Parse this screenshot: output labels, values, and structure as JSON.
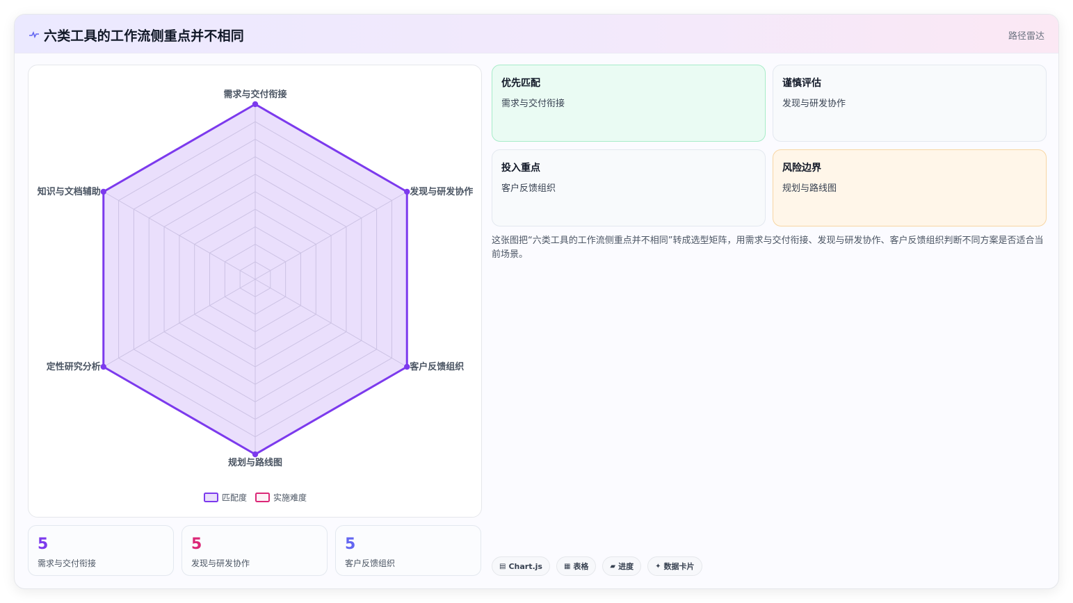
{
  "header": {
    "title": "六类工具的工作流侧重点并不相同",
    "tag": "路径雷达",
    "icon": "pulse-icon"
  },
  "chart_data": {
    "type": "radar",
    "categories": [
      "需求与交付衔接",
      "发现与研发协作",
      "客户反馈组织",
      "规划与路线图",
      "定性研究分析",
      "知识与文档辅助"
    ],
    "series": [
      {
        "name": "匹配度",
        "values": [
          5,
          5,
          5,
          5,
          5,
          5
        ],
        "color": "#7c3aed"
      },
      {
        "name": "实施难度",
        "values": [],
        "color": "#db2777"
      }
    ],
    "rlim": [
      0,
      5
    ],
    "grid": true,
    "legend_position": "bottom"
  },
  "stats": [
    {
      "value": "5",
      "label": "需求与交付衔接",
      "color": "#7c3aed"
    },
    {
      "value": "5",
      "label": "发现与研发协作",
      "color": "#db2777"
    },
    {
      "value": "5",
      "label": "客户反馈组织",
      "color": "#6366f1"
    }
  ],
  "cards": [
    {
      "title": "优先匹配",
      "sub": "需求与交付衔接"
    },
    {
      "title": "谨慎评估",
      "sub": "发现与研发协作"
    },
    {
      "title": "投入重点",
      "sub": "客户反馈组织"
    },
    {
      "title": "风险边界",
      "sub": "规划与路线图"
    }
  ],
  "description": "这张图把“六类工具的工作流侧重点并不相同”转成选型矩阵，用需求与交付衔接、发现与研发协作、客户反馈组织判断不同方案是否适合当前场景。",
  "chips": [
    {
      "icon": "▤",
      "label": "Chart.js"
    },
    {
      "icon": "▦",
      "label": "表格"
    },
    {
      "icon": "▰",
      "label": "进度"
    },
    {
      "icon": "✦",
      "label": "数据卡片"
    }
  ]
}
